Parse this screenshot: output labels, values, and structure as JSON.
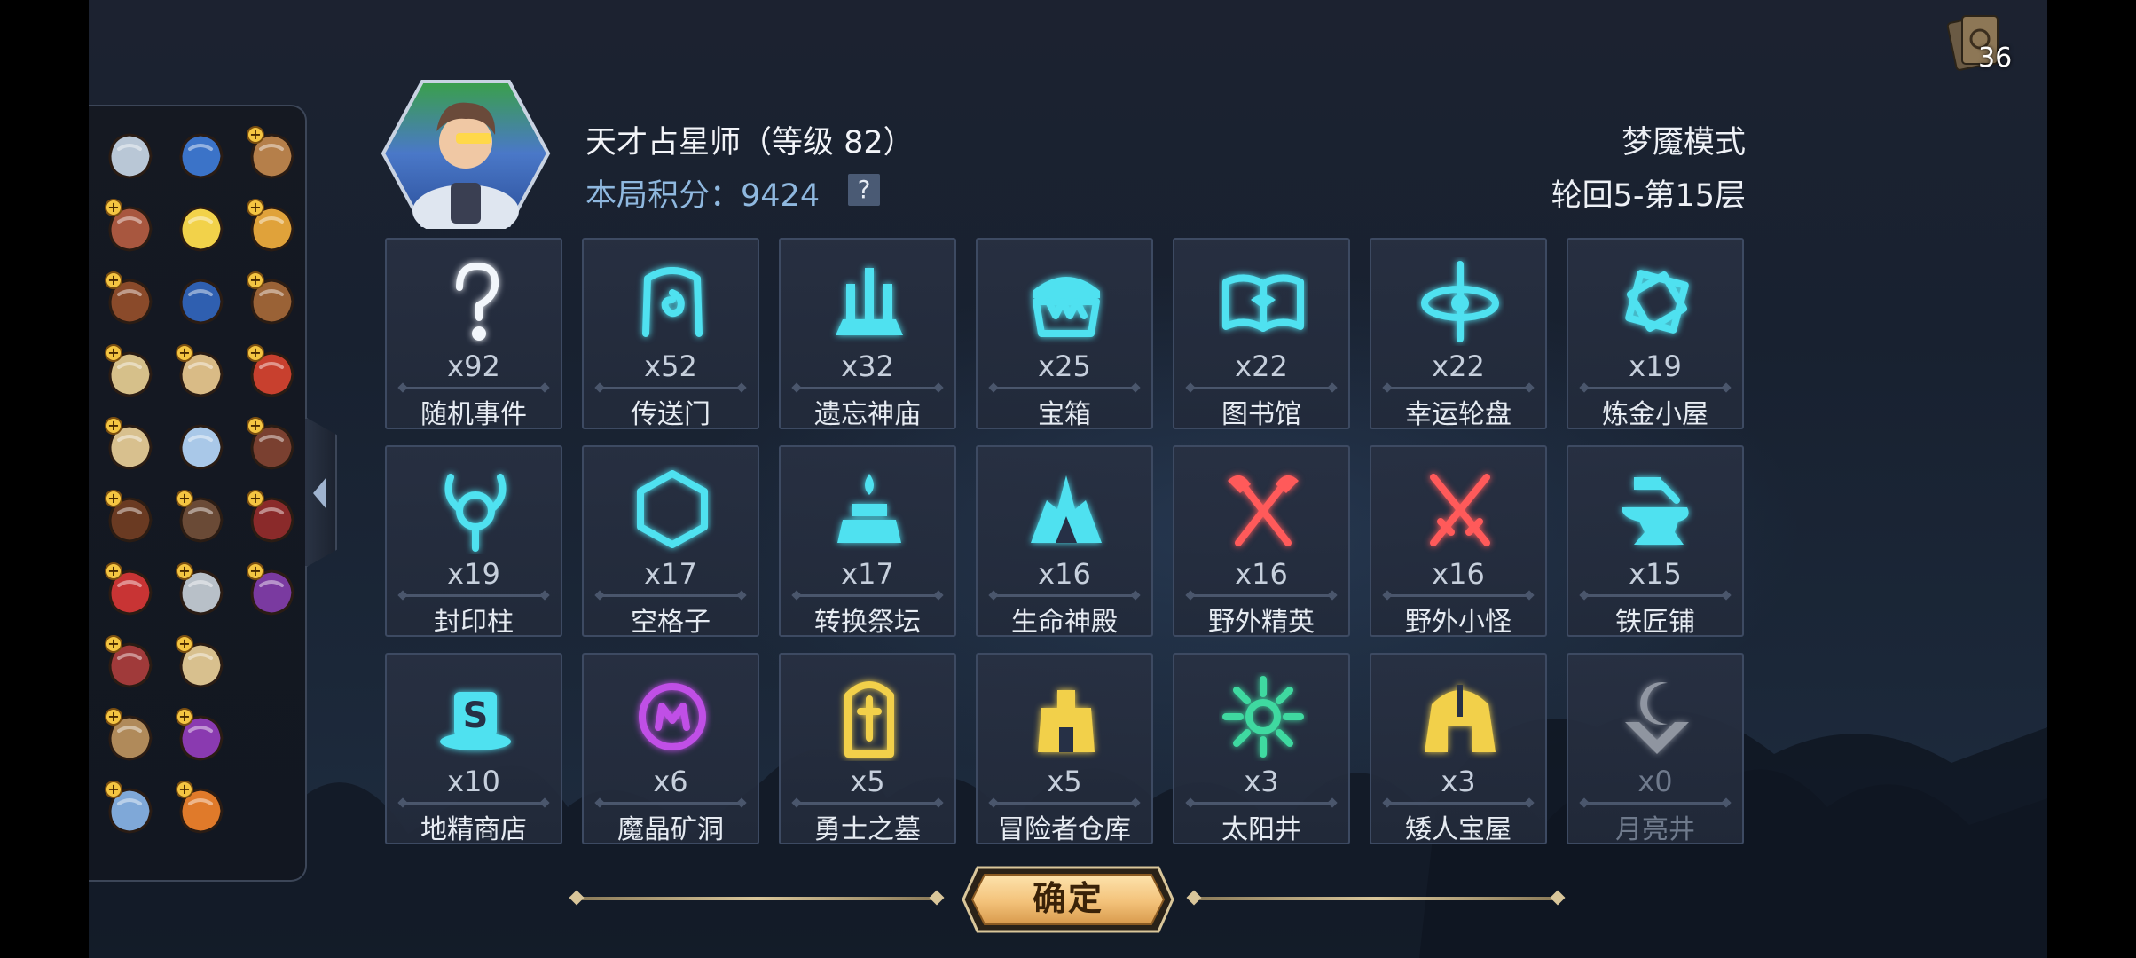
{
  "header": {
    "title": "天才占星师（等级 82）",
    "score_label": "本局积分：",
    "score_value": "9424",
    "help_label": "?",
    "mode": "梦魇模式",
    "floor": "轮回5-第15层",
    "deck_count": "36"
  },
  "rooms": [
    {
      "count": "x92",
      "label": "随机事件",
      "icon": "question-mark-icon",
      "color": "#f2f6fb"
    },
    {
      "count": "x52",
      "label": "传送门",
      "icon": "portal-icon",
      "color": "#4fe1f0"
    },
    {
      "count": "x32",
      "label": "遗忘神庙",
      "icon": "temple-icon",
      "color": "#4fe1f0"
    },
    {
      "count": "x25",
      "label": "宝箱",
      "icon": "treasure-chest-icon",
      "color": "#4fe1f0"
    },
    {
      "count": "x22",
      "label": "图书馆",
      "icon": "library-book-icon",
      "color": "#4fe1f0"
    },
    {
      "count": "x22",
      "label": "幸运轮盘",
      "icon": "lucky-wheel-icon",
      "color": "#4fe1f0"
    },
    {
      "count": "x19",
      "label": "炼金小屋",
      "icon": "alchemy-icon",
      "color": "#4fe1f0"
    },
    {
      "count": "x19",
      "label": "封印柱",
      "icon": "seal-pillar-icon",
      "color": "#4fe1f0"
    },
    {
      "count": "x17",
      "label": "空格子",
      "icon": "empty-hexagon-icon",
      "color": "#4fe1f0"
    },
    {
      "count": "x17",
      "label": "转换祭坛",
      "icon": "altar-icon",
      "color": "#4fe1f0"
    },
    {
      "count": "x16",
      "label": "生命神殿",
      "icon": "life-shrine-icon",
      "color": "#4fe1f0"
    },
    {
      "count": "x16",
      "label": "野外精英",
      "icon": "crossed-axes-icon",
      "color": "#ff5a5a"
    },
    {
      "count": "x16",
      "label": "野外小怪",
      "icon": "crossed-swords-icon",
      "color": "#ff5a5a"
    },
    {
      "count": "x15",
      "label": "铁匠铺",
      "icon": "anvil-icon",
      "color": "#4fe1f0"
    },
    {
      "count": "x10",
      "label": "地精商店",
      "icon": "goblin-shop-icon",
      "color": "#4fe1f0"
    },
    {
      "count": "x6",
      "label": "魔晶矿洞",
      "icon": "crystal-mine-icon",
      "color": "#c04fe6"
    },
    {
      "count": "x5",
      "label": "勇士之墓",
      "icon": "tomb-icon",
      "color": "#f2d04a"
    },
    {
      "count": "x5",
      "label": "冒险者仓库",
      "icon": "warehouse-icon",
      "color": "#f2d04a"
    },
    {
      "count": "x3",
      "label": "太阳井",
      "icon": "sun-well-icon",
      "color": "#3fd9a0"
    },
    {
      "count": "x3",
      "label": "矮人宝屋",
      "icon": "dwarf-vault-icon",
      "color": "#f2d04a"
    },
    {
      "count": "x0",
      "label": "月亮井",
      "icon": "moon-well-icon",
      "color": "#e8ecf2"
    }
  ],
  "inventory": [
    "crossbow-icon",
    "blue-gem-icon",
    "gift-box-icon",
    "meat-icon",
    "pinwheel-icon",
    "gloves-icon",
    "red-book-icon",
    "mystery-card-icon",
    "backpack-icon",
    "paint-palette-icon",
    "scroll-icon",
    "red-horn-icon",
    "parchment-icon",
    "flower-icon",
    "helmet-icon",
    "bagpipe-icon",
    "leather-book-icon",
    "green-gem-book-icon",
    "red-dragon-icon",
    "stone-tablet-icon",
    "wizard-hat-icon",
    "spellbook-icon",
    "map-icon",
    "",
    "coin-bag-icon",
    "purple-orb-icon",
    "",
    "card-deck-icon",
    "spiked-shell-icon",
    ""
  ],
  "confirm_label": "确定"
}
